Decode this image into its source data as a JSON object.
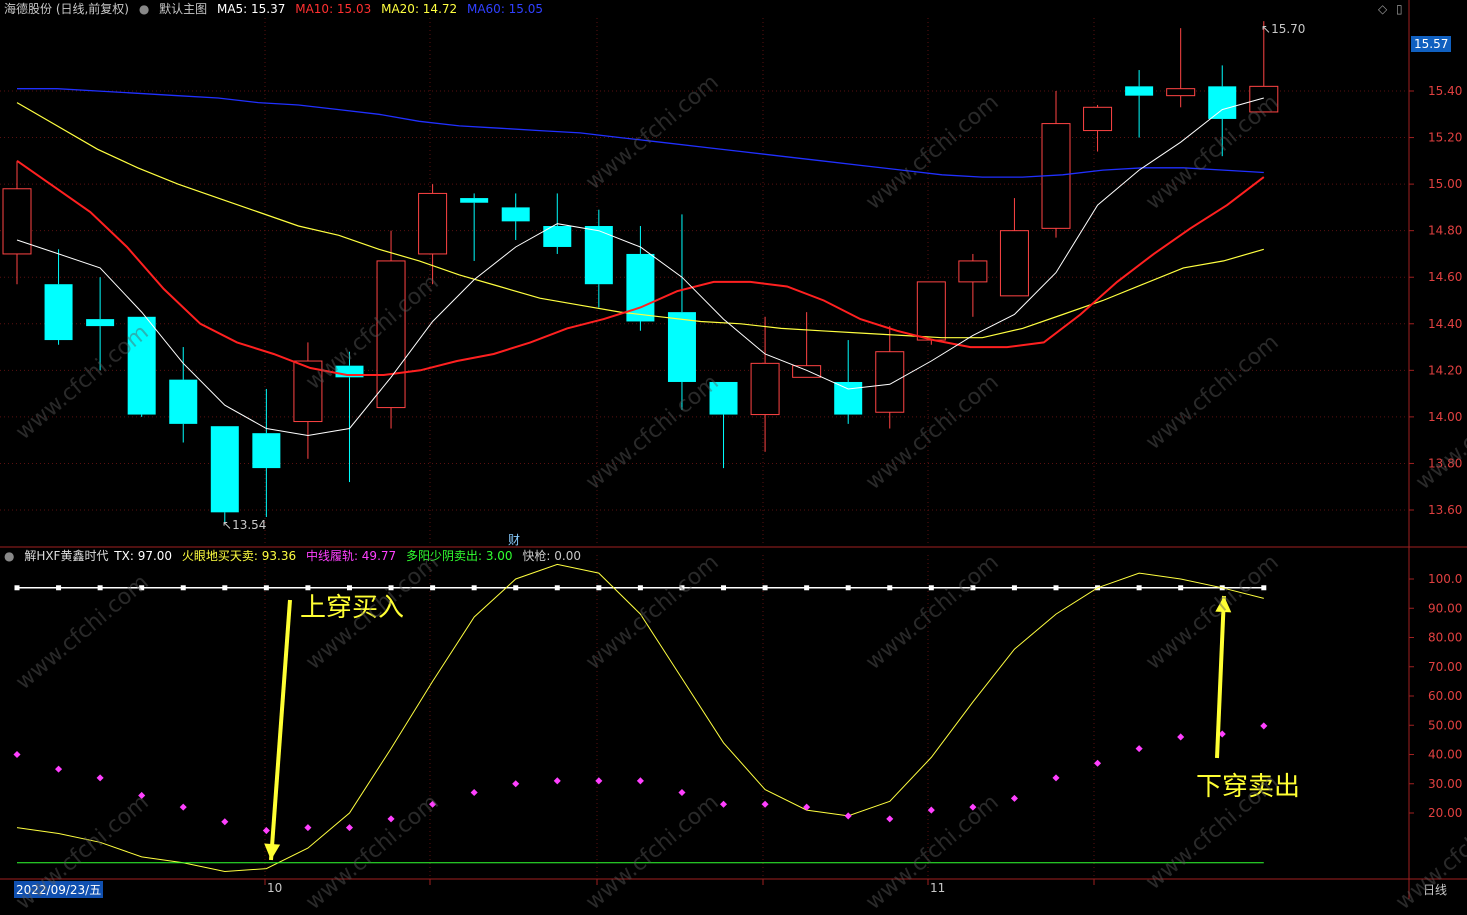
{
  "header": {
    "stock": "海德股份 (日线,前复权)",
    "template": "默认主图",
    "ma5_label": "MA5: 15.37",
    "ma10_label": "MA10: 15.03",
    "ma20_label": "MA20: 14.72",
    "ma60_label": "MA60: 15.05",
    "ma5_color": "#ffffff",
    "ma10_color": "#ff2020",
    "ma20_color": "#ffff40",
    "ma60_color": "#2030ff"
  },
  "indicator_header": {
    "name": "解HXF黄鑫时代",
    "tx": "TX: 97.00",
    "line1": "火眼地买天卖: 93.36",
    "line2": "中线履轨: 49.77",
    "line3": "多阳少阴卖出: 3.00",
    "line4": "快枪: 0.00"
  },
  "price_axis": [
    "15.40",
    "15.20",
    "15.00",
    "14.80",
    "14.60",
    "14.40",
    "14.20",
    "14.00",
    "13.80",
    "13.60"
  ],
  "current_price": "15.57",
  "high_marker": "15.70",
  "low_marker": "13.54",
  "indicator_axis": [
    "100.0",
    "90.00",
    "80.00",
    "70.00",
    "60.00",
    "50.00",
    "40.00",
    "30.00",
    "20.00"
  ],
  "date_axis": {
    "start": "2022/09/23/五",
    "m10": "10",
    "m11": "11"
  },
  "period_label": "日线",
  "finance_mark": "财",
  "annotations": {
    "buy": "上穿买入",
    "sell": "下穿卖出"
  },
  "watermark": "www.cfchi.com",
  "chart_data": [
    {
      "type": "candlestick",
      "title": "海德股份 (日线,前复权)",
      "ylim": [
        13.5,
        15.75
      ],
      "candles": [
        {
          "o": 14.7,
          "h": 15.1,
          "l": 14.57,
          "c": 14.98
        },
        {
          "o": 14.57,
          "h": 14.72,
          "l": 14.31,
          "c": 14.33
        },
        {
          "o": 14.42,
          "h": 14.6,
          "l": 14.2,
          "c": 14.39
        },
        {
          "o": 14.43,
          "h": 14.43,
          "l": 14.0,
          "c": 14.01
        },
        {
          "o": 14.16,
          "h": 14.3,
          "l": 13.89,
          "c": 13.97
        },
        {
          "o": 13.96,
          "h": 13.96,
          "l": 13.54,
          "c": 13.59
        },
        {
          "o": 13.93,
          "h": 14.12,
          "l": 13.57,
          "c": 13.78
        },
        {
          "o": 13.98,
          "h": 14.32,
          "l": 13.82,
          "c": 14.24
        },
        {
          "o": 14.22,
          "h": 14.28,
          "l": 13.72,
          "c": 14.17
        },
        {
          "o": 14.04,
          "h": 14.8,
          "l": 13.95,
          "c": 14.67
        },
        {
          "o": 14.7,
          "h": 15.0,
          "l": 14.57,
          "c": 14.96
        },
        {
          "o": 14.94,
          "h": 14.96,
          "l": 14.67,
          "c": 14.92
        },
        {
          "o": 14.9,
          "h": 14.96,
          "l": 14.76,
          "c": 14.84
        },
        {
          "o": 14.82,
          "h": 14.96,
          "l": 14.7,
          "c": 14.73
        },
        {
          "o": 14.82,
          "h": 14.89,
          "l": 14.47,
          "c": 14.57
        },
        {
          "o": 14.7,
          "h": 14.82,
          "l": 14.37,
          "c": 14.41
        },
        {
          "o": 14.45,
          "h": 14.87,
          "l": 14.03,
          "c": 14.15
        },
        {
          "o": 14.15,
          "h": 14.15,
          "l": 13.78,
          "c": 14.01
        },
        {
          "o": 14.01,
          "h": 14.43,
          "l": 13.85,
          "c": 14.23
        },
        {
          "o": 14.17,
          "h": 14.45,
          "l": 14.17,
          "c": 14.22
        },
        {
          "o": 14.15,
          "h": 14.33,
          "l": 13.97,
          "c": 14.01
        },
        {
          "o": 14.02,
          "h": 14.39,
          "l": 13.95,
          "c": 14.28
        },
        {
          "o": 14.33,
          "h": 14.58,
          "l": 14.31,
          "c": 14.58
        },
        {
          "o": 14.58,
          "h": 14.7,
          "l": 14.43,
          "c": 14.67
        },
        {
          "o": 14.52,
          "h": 14.94,
          "l": 14.52,
          "c": 14.8
        },
        {
          "o": 14.81,
          "h": 15.4,
          "l": 14.77,
          "c": 15.26
        },
        {
          "o": 15.23,
          "h": 15.34,
          "l": 15.14,
          "c": 15.33
        },
        {
          "o": 15.42,
          "h": 15.49,
          "l": 15.2,
          "c": 15.38
        },
        {
          "o": 15.38,
          "h": 15.67,
          "l": 15.33,
          "c": 15.41
        },
        {
          "o": 15.42,
          "h": 15.51,
          "l": 15.12,
          "c": 15.28
        },
        {
          "o": 15.31,
          "h": 15.7,
          "l": 15.31,
          "c": 15.42
        }
      ],
      "ma5": [
        14.76,
        14.7,
        14.64,
        14.45,
        14.23,
        14.05,
        13.95,
        13.92,
        13.95,
        14.17,
        14.41,
        14.59,
        14.73,
        14.83,
        14.8,
        14.73,
        14.6,
        14.42,
        14.27,
        14.2,
        14.12,
        14.14,
        14.24,
        14.35,
        14.44,
        14.62,
        14.91,
        15.06,
        15.18,
        15.32,
        15.37
      ],
      "ma10": [
        15.1,
        14.99,
        14.88,
        14.73,
        14.55,
        14.4,
        14.32,
        14.27,
        14.21,
        14.18,
        14.18,
        14.2,
        14.24,
        14.27,
        14.32,
        14.38,
        14.42,
        14.47,
        14.54,
        14.58,
        14.58,
        14.56,
        14.5,
        14.42,
        14.37,
        14.33,
        14.3,
        14.3,
        14.32,
        14.44,
        14.58,
        14.7,
        14.81,
        14.91,
        15.03
      ],
      "ma20": [
        15.35,
        15.25,
        15.15,
        15.07,
        15.0,
        14.94,
        14.88,
        14.82,
        14.78,
        14.72,
        14.67,
        14.61,
        14.56,
        14.51,
        14.48,
        14.45,
        14.43,
        14.41,
        14.4,
        14.38,
        14.37,
        14.36,
        14.35,
        14.34,
        14.34,
        14.38,
        14.44,
        14.5,
        14.57,
        14.64,
        14.67,
        14.72
      ],
      "ma60": [
        15.41,
        15.41,
        15.4,
        15.39,
        15.38,
        15.37,
        15.35,
        15.34,
        15.32,
        15.3,
        15.27,
        15.25,
        15.24,
        15.23,
        15.22,
        15.2,
        15.18,
        15.16,
        15.14,
        15.12,
        15.1,
        15.08,
        15.06,
        15.04,
        15.03,
        15.03,
        15.04,
        15.06,
        15.07,
        15.07,
        15.06,
        15.05
      ]
    },
    {
      "type": "line",
      "title": "解HXF黄鑫时代",
      "ylim": [
        0,
        105
      ],
      "series": [
        {
          "name": "TX",
          "values": [
            97,
            97,
            97,
            97,
            97,
            97,
            97,
            97,
            97,
            97,
            97,
            97,
            97,
            97,
            97,
            97,
            97,
            97,
            97,
            97,
            97,
            97,
            97,
            97,
            97,
            97,
            97,
            97,
            97,
            97,
            97
          ]
        },
        {
          "name": "火眼地买天卖",
          "values": [
            15,
            13,
            10,
            5,
            3,
            0,
            1,
            8,
            20,
            42,
            65,
            87,
            100,
            105,
            102,
            88,
            66,
            44,
            28,
            21,
            19,
            24,
            39,
            58,
            76,
            88,
            97,
            102,
            100,
            97,
            93.36
          ]
        },
        {
          "name": "中线履轨",
          "values": [
            40,
            35,
            32,
            26,
            22,
            17,
            14,
            15,
            15,
            18,
            23,
            27,
            30,
            31,
            31,
            31,
            27,
            23,
            23,
            22,
            19,
            18,
            21,
            22,
            25,
            32,
            37,
            42,
            46,
            47,
            49.77
          ]
        },
        {
          "name": "多阳少阴卖出",
          "values": [
            3,
            3,
            3,
            3,
            3,
            3,
            3,
            3,
            3,
            3,
            3,
            3,
            3,
            3,
            3,
            3,
            3,
            3,
            3,
            3,
            3,
            3,
            3,
            3,
            3,
            3,
            3,
            3,
            3,
            3,
            3
          ]
        }
      ]
    }
  ]
}
